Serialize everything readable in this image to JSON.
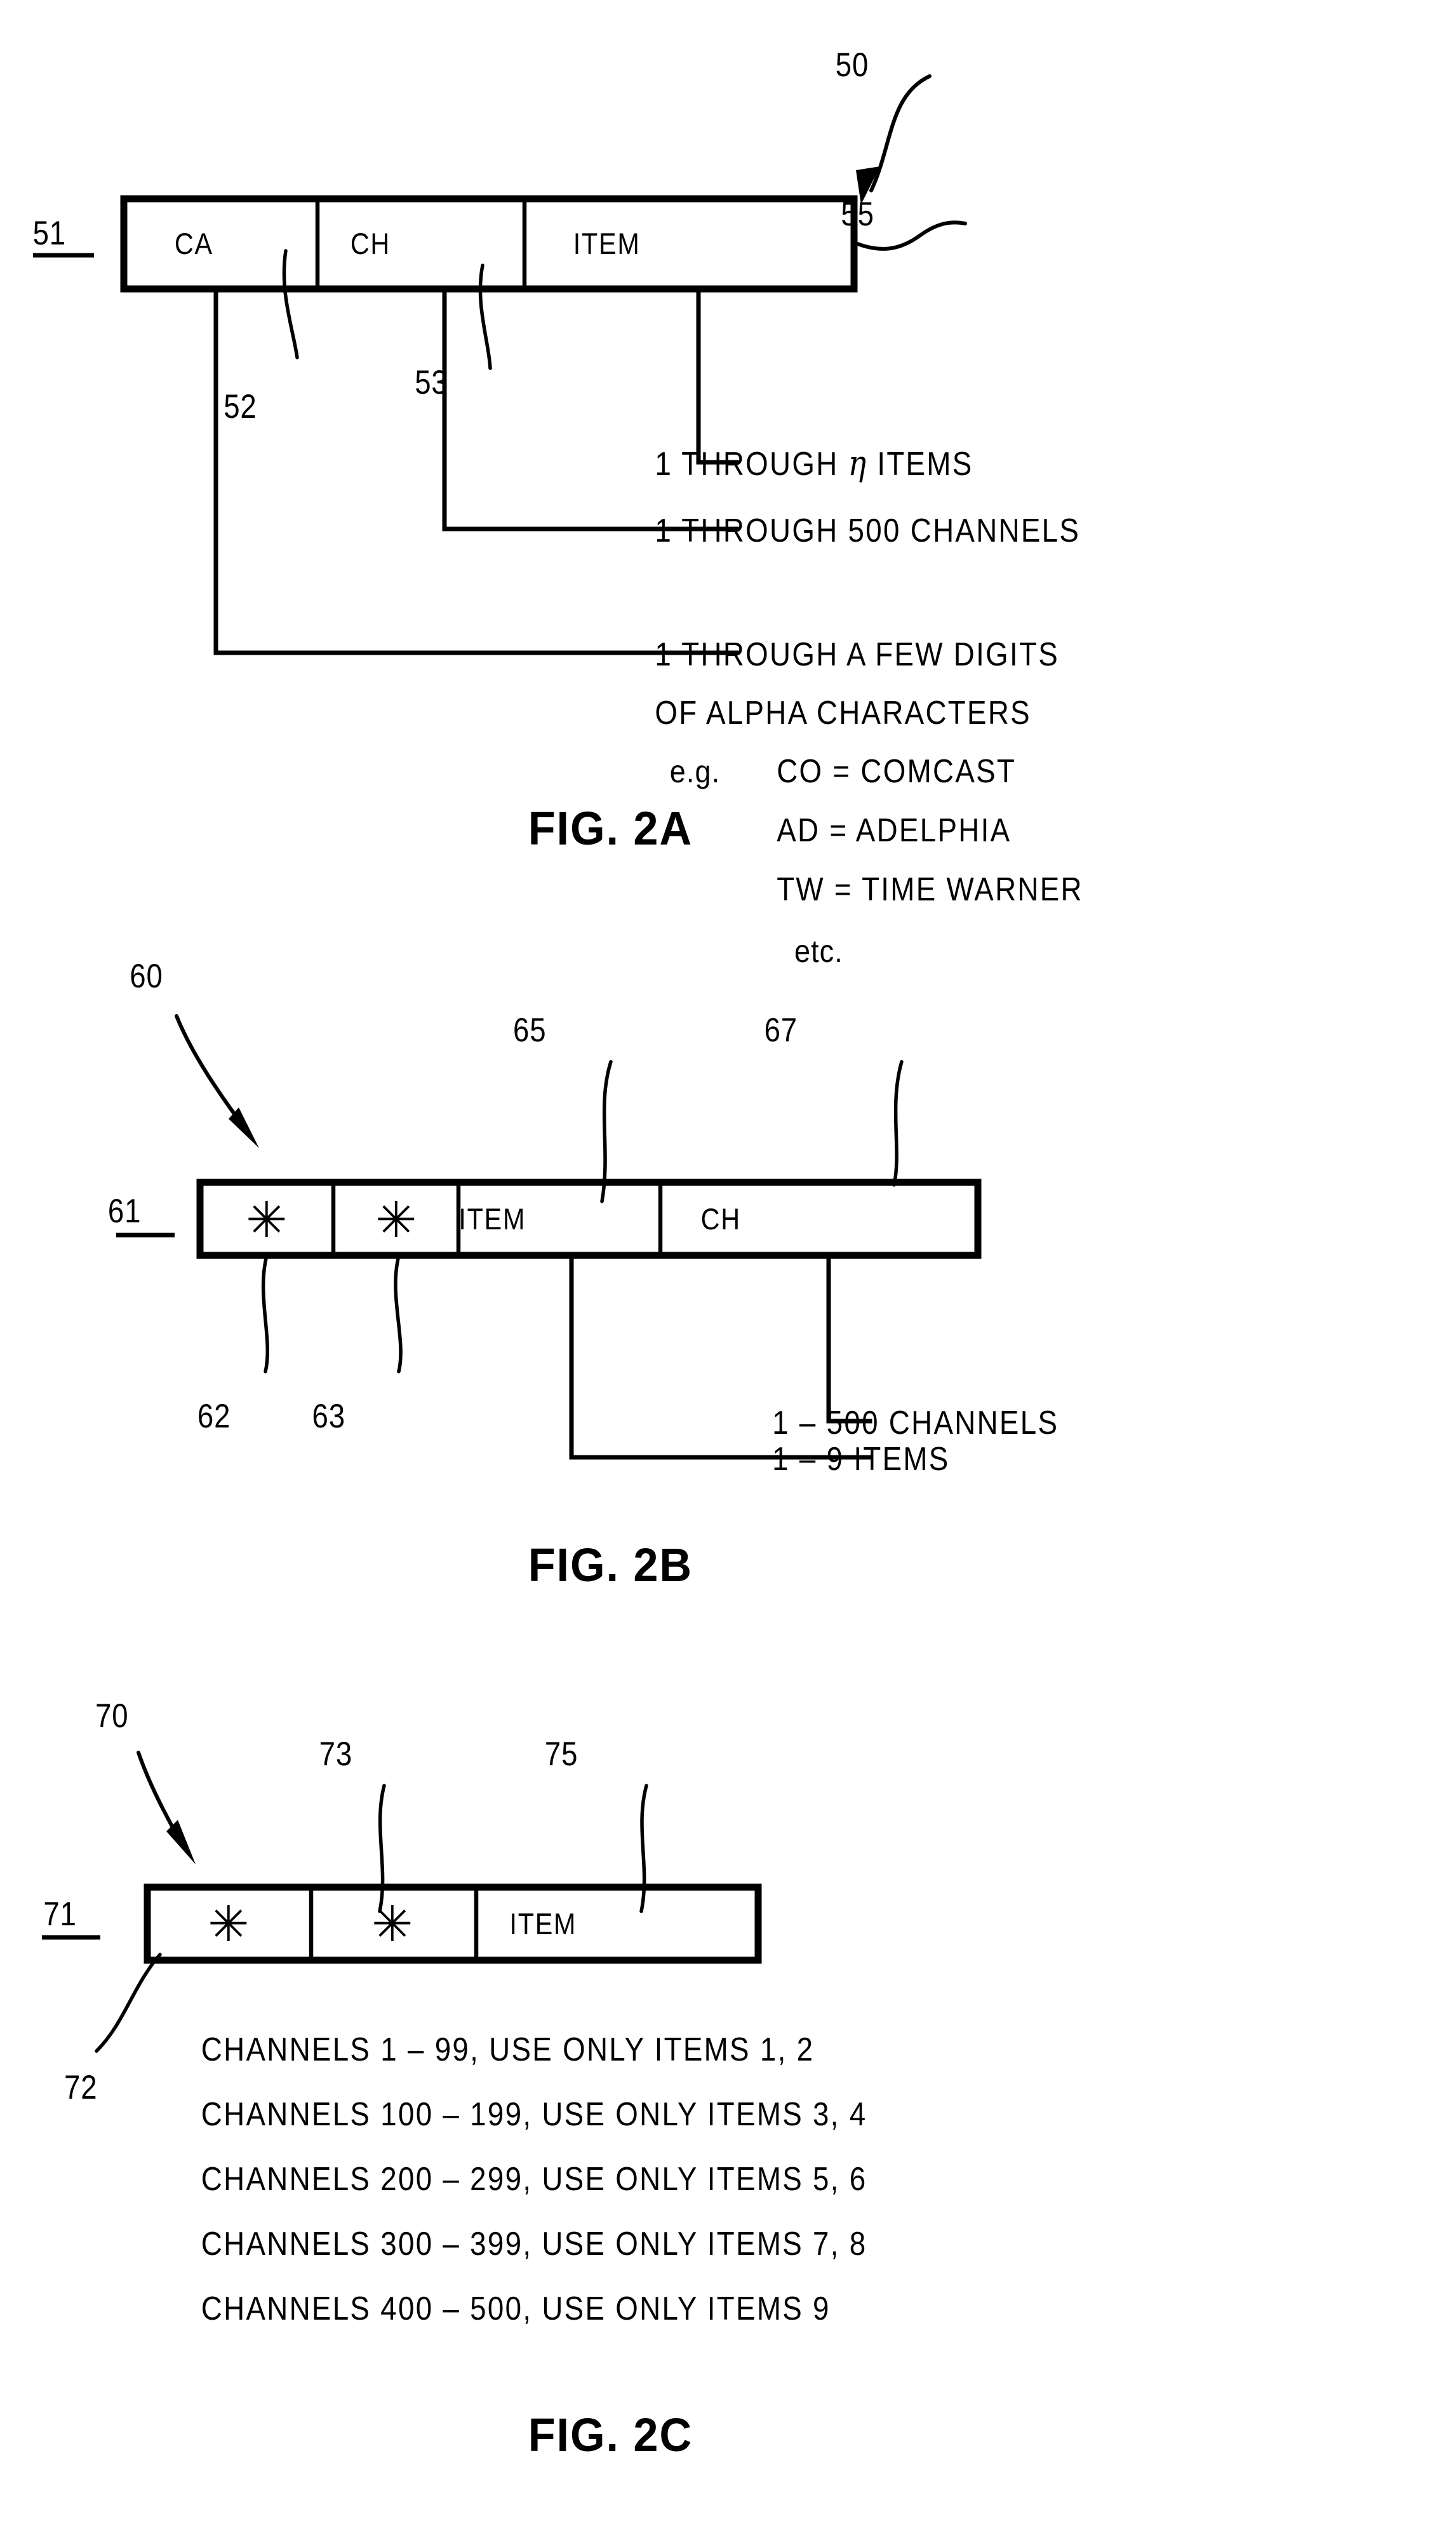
{
  "figures": [
    {
      "id": "fig2a",
      "caption": "FIG. 2A",
      "record_ref": "51",
      "pointer_ref": "50",
      "tail_ref": "55",
      "cells": [
        {
          "label": "CA",
          "ref": "52"
        },
        {
          "label": "CH",
          "ref": "53"
        },
        {
          "label": "ITEM",
          "ref": ""
        }
      ],
      "annotations": [
        {
          "pre": "1  THROUGH  ",
          "sym": "η",
          "post": "  ITEMS"
        },
        {
          "pre": "1  THROUGH  500  CHANNELS",
          "sym": "",
          "post": ""
        },
        {
          "pre": "1  THROUGH  A  FEW  DIGITS",
          "sym": "",
          "post": ""
        }
      ],
      "annotation_cont": "OF  ALPHA  CHARACTERS",
      "examples_lead": "e.g.",
      "examples": [
        "CO  =  COMCAST",
        "AD  =  ADELPHIA",
        "TW  =  TIME  WARNER",
        "etc."
      ]
    },
    {
      "id": "fig2b",
      "caption": "FIG. 2B",
      "record_ref": "61",
      "pointer_ref": "60",
      "cells": [
        {
          "label": "✳",
          "ref": "62"
        },
        {
          "label": "✳",
          "ref": "63"
        },
        {
          "label": "ITEM",
          "ref": "65"
        },
        {
          "label": "CH",
          "ref": "67"
        }
      ],
      "annotations": [
        "1  –  500  CHANNELS",
        "1  –  9  ITEMS"
      ]
    },
    {
      "id": "fig2c",
      "caption": "FIG. 2C",
      "record_ref": "71",
      "pointer_ref": "70",
      "cells": [
        {
          "label": "✳",
          "ref": "72"
        },
        {
          "label": "✳",
          "ref": "73"
        },
        {
          "label": "ITEM",
          "ref": "75"
        }
      ],
      "rules": [
        "CHANNELS  1  –  99,  USE  ONLY  ITEMS  1,  2",
        "CHANNELS  100  –  199,  USE  ONLY  ITEMS  3,  4",
        "CHANNELS  200  –  299,  USE  ONLY  ITEMS  5,  6",
        "CHANNELS  300  –  399,  USE  ONLY  ITEMS  7,  8",
        "CHANNELS  400  –  500,  USE  ONLY  ITEMS  9"
      ]
    }
  ]
}
